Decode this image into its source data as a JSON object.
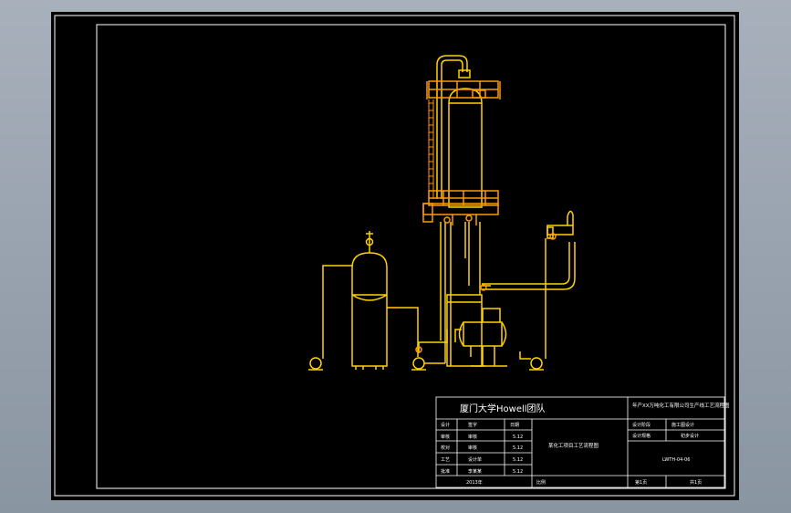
{
  "colors": {
    "background": "#000000",
    "frame": "#ffffff",
    "equipment": "#ffd200",
    "equipment_orange": "#ff9a00",
    "workspace": "#8e99a6"
  },
  "title_block": {
    "org": "厦门大学Howell团队",
    "project": "年产XX万吨化工有限公司生产线工艺流程图",
    "drawing_name": "某化工项目工艺流程图",
    "drawing_no": "LWTH-04-06",
    "rows": [
      {
        "role": "设计",
        "name": "签字",
        "date": "日期"
      },
      {
        "role": "审核",
        "name": "审核",
        "date": "5.12"
      },
      {
        "role": "校对",
        "name": "审核",
        "date": "5.12"
      },
      {
        "role": "工艺",
        "name": "设计单",
        "date": "5.12"
      },
      {
        "role": "批准",
        "name": "李某某",
        "date": "5.12"
      }
    ],
    "year": "2013年",
    "scale_label": "比例",
    "stage_label": "设计阶段",
    "stage_value": "施工图设计",
    "spec_label": "设计规格",
    "spec_value": "初步设计",
    "sheet_label": "第1页",
    "total_label": "共1页"
  }
}
